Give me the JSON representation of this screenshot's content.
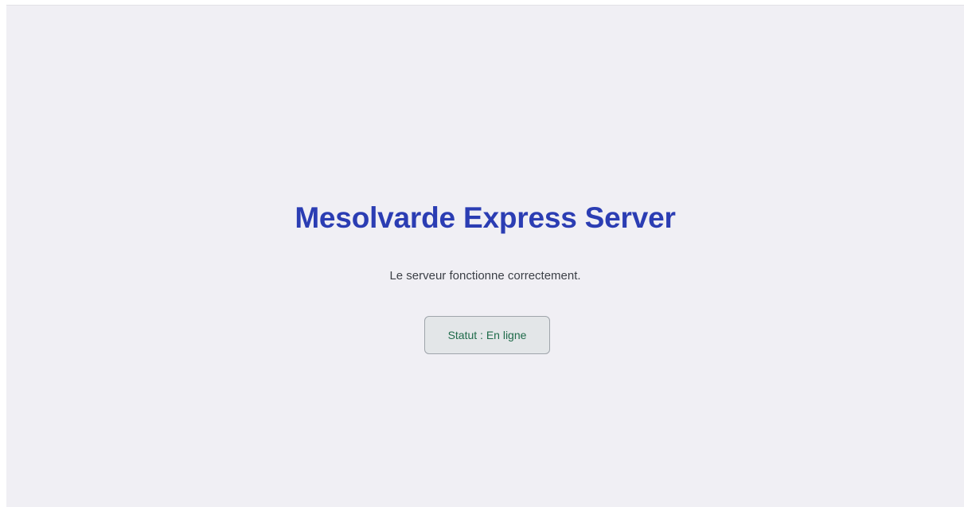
{
  "page": {
    "title": "Mesolvarde Express Server",
    "message": "Le serveur fonctionne correctement.",
    "status_label": "Statut : En ligne"
  },
  "colors": {
    "title": "#2b3db3",
    "message": "#3b3f46",
    "status_text": "#1f6b4a",
    "background": "#f0eff4"
  }
}
